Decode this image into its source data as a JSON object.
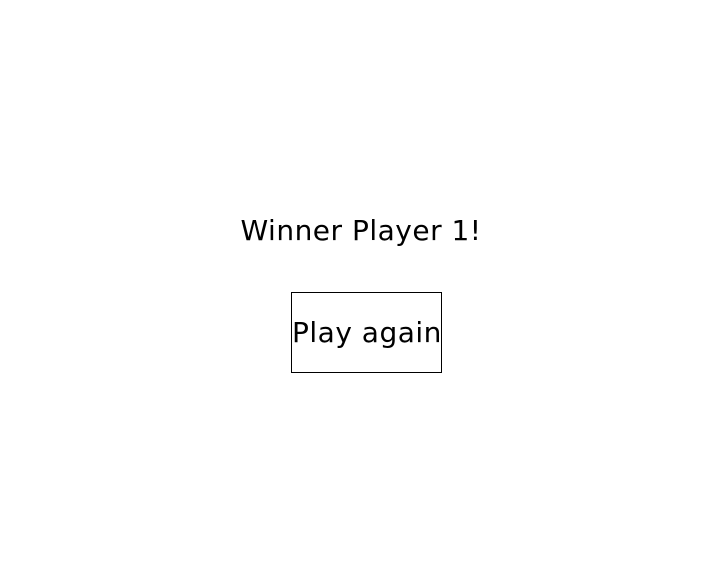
{
  "game_over": {
    "message": "Winner Player 1!",
    "play_again_label": "Play again"
  }
}
